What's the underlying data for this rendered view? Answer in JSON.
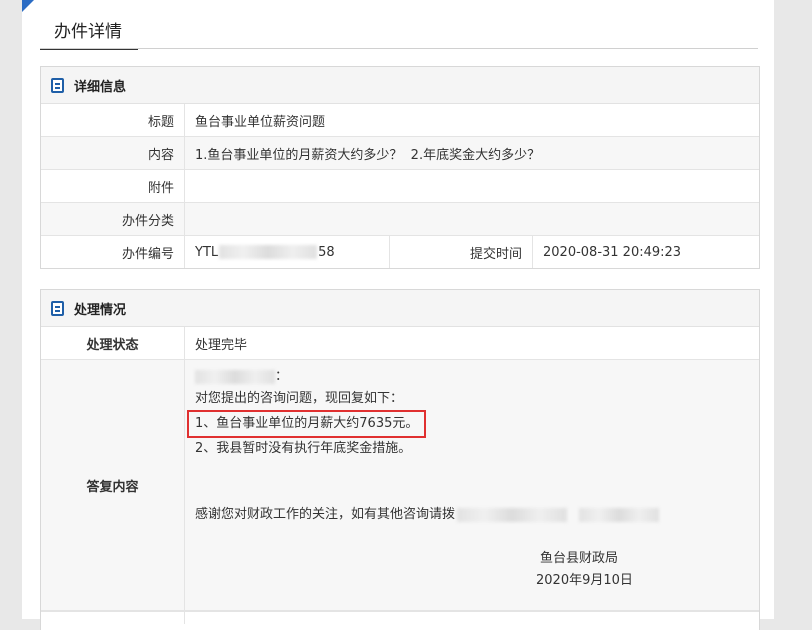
{
  "page": {
    "title": "办件详情"
  },
  "detail": {
    "section_title": "详细信息",
    "rows": {
      "subject_label": "标题",
      "subject_value": "鱼台事业单位薪资问题",
      "content_label": "内容",
      "content_value": "1.鱼台事业单位的月薪资大约多少？  2.年底奖金大约多少？",
      "attachment_label": "附件",
      "attachment_value": "",
      "category_label": "办件分类",
      "category_value": "",
      "number_label": "办件编号",
      "number_prefix": "YTL",
      "number_suffix": "58",
      "submit_label": "提交时间",
      "submit_value": "2020-08-31 20:49:23"
    }
  },
  "process": {
    "section_title": "处理情况",
    "status_label": "处理状态",
    "status_value": "处理完毕",
    "reply_label": "答复内容",
    "reply": {
      "greeting_tail": "：",
      "intro": "对您提出的咨询问题，现回复如下：",
      "item1": "1、鱼台事业单位的月薪大约7635元。",
      "item2": "2、我县暂时没有执行年底奖金措施。",
      "thanks": "感谢您对财政工作的关注，如有其他咨询请拨",
      "signer": "鱼台县财政局",
      "date": "2020年9月10日"
    }
  }
}
